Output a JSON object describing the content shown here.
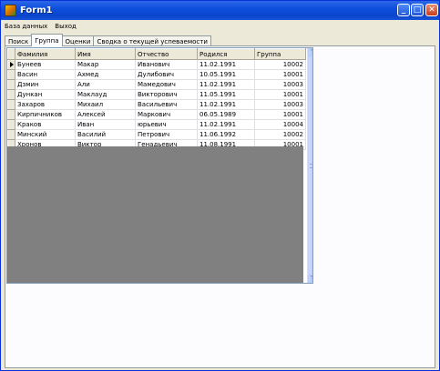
{
  "window": {
    "title": "Form1"
  },
  "titlebar_buttons": {
    "min": "_",
    "max": "□",
    "close": "✕"
  },
  "menu": {
    "items": [
      "База данных",
      "Выход"
    ]
  },
  "tabs": [
    {
      "label": "Поиск",
      "active": false
    },
    {
      "label": "Группа",
      "active": true
    },
    {
      "label": "Оценки",
      "active": false
    },
    {
      "label": "Сводка о текущей успеваемости",
      "active": false
    }
  ],
  "grid": {
    "columns": [
      "Фамилия",
      "Имя",
      "Отчество",
      "Родился",
      "Группа"
    ],
    "rows": [
      [
        "Бунеев",
        "Макар",
        "Иванович",
        "11.02.1991",
        "10002"
      ],
      [
        "Васин",
        "Ахмед",
        "Дулибович",
        "10.05.1991",
        "10001"
      ],
      [
        "Дзмин",
        "Али",
        "Мамедович",
        "11.02.1991",
        "10003"
      ],
      [
        "Дункан",
        "Маклауд",
        "Викторович",
        "11.05.1991",
        "10001"
      ],
      [
        "Захаров",
        "Михаил",
        "Васильевич",
        "11.02.1991",
        "10003"
      ],
      [
        "Кирпичников",
        "Алексей",
        "Маркович",
        "06.05.1989",
        "10001"
      ],
      [
        "Краков",
        "Иван",
        "юрьевич",
        "11.02.1991",
        "10004"
      ],
      [
        "Минский",
        "Василий",
        "Петрович",
        "11.06.1992",
        "10002"
      ],
      [
        "Хронов",
        "Виктор",
        "Генадьевич",
        "11.08.1991",
        "10001"
      ]
    ],
    "current_row": 0
  },
  "scrollbar": {
    "up": "˄",
    "down": "˅"
  },
  "colors": {
    "titlebar": "#0a45cc",
    "window_bg": "#ece9d8",
    "grid_empty": "#808080"
  }
}
